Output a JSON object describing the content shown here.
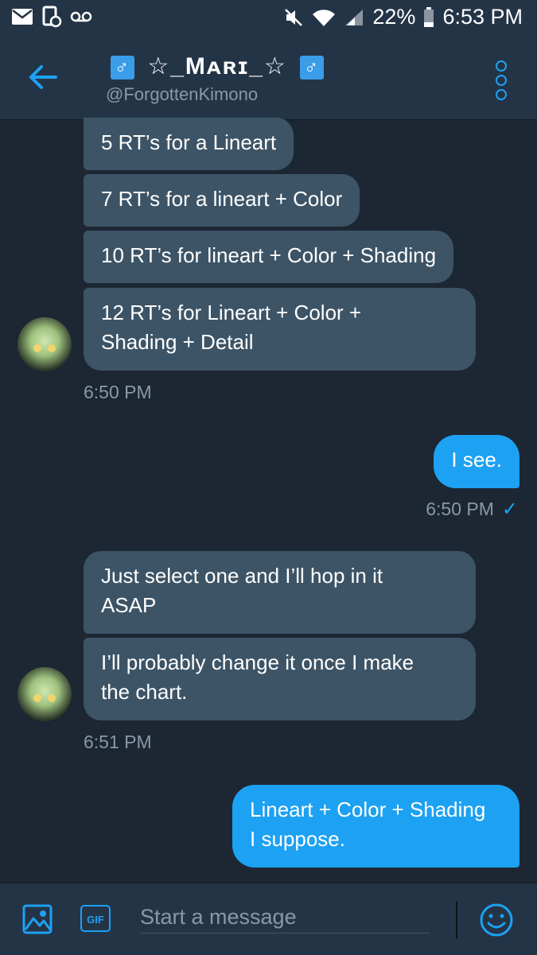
{
  "statusbar": {
    "battery": "22%",
    "time": "6:53 PM"
  },
  "header": {
    "title": "☆_Mᴀʀɪ_☆",
    "handle": "@ForgottenKimono",
    "title_emoji": "♂"
  },
  "messages": {
    "in1": "5 RT’s for a Lineart",
    "in2": "7 RT’s for a lineart + Color",
    "in3": "10 RT’s for lineart + Color + Shading",
    "in4": "12 RT’s for Lineart + Color +\nShading + Detail",
    "ts1": "6:50 PM",
    "out1": "I see.",
    "ts2": "6:50 PM",
    "in5": "Just select one and I’ll hop in it\nASAP",
    "in6": "I’ll probably change it once I make\nthe chart.",
    "ts3": "6:51 PM",
    "out2": "Lineart + Color + Shading\nI suppose."
  },
  "composer": {
    "placeholder": "Start a message",
    "gif_label": "GIF"
  },
  "colors": {
    "background": "#1c2733",
    "header": "#243447",
    "incoming_bubble": "#3d5466",
    "outgoing_bubble": "#1da1f2",
    "accent": "#1da1f2"
  }
}
